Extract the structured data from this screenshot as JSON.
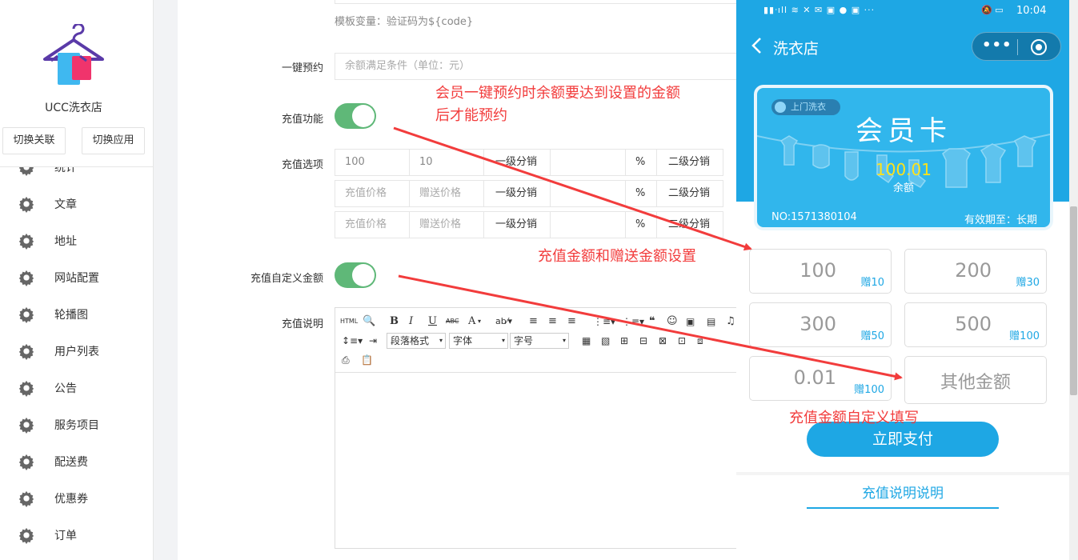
{
  "sidebar": {
    "shop_name": "UCC洗衣店",
    "buttons": [
      "切换关联",
      "切换应用"
    ],
    "items": [
      {
        "label": "统计"
      },
      {
        "label": "文章"
      },
      {
        "label": "地址"
      },
      {
        "label": "网站配置"
      },
      {
        "label": "轮播图"
      },
      {
        "label": "用户列表"
      },
      {
        "label": "公告"
      },
      {
        "label": "服务项目"
      },
      {
        "label": "配送费"
      },
      {
        "label": "优惠券"
      },
      {
        "label": "订单"
      }
    ]
  },
  "form": {
    "template_hint": "模板变量：验证码为${code}",
    "one_click": {
      "label": "一键预约",
      "placeholder": "余额满足条件（单位：元）"
    },
    "recharge_toggle": {
      "label": "充值功能",
      "on": true
    },
    "recharge_options": {
      "label": "充值选项",
      "rows": [
        {
          "price": "100",
          "gift": "10",
          "level1": "一级分销",
          "percent": "%",
          "level2": "二级分销",
          "price_is_value": true
        },
        {
          "price": "充值价格",
          "gift": "赠送价格",
          "level1": "一级分销",
          "percent": "%",
          "level2": "二级分销",
          "price_is_value": false
        },
        {
          "price": "充值价格",
          "gift": "赠送价格",
          "level1": "一级分销",
          "percent": "%",
          "level2": "二级分销",
          "price_is_value": false
        }
      ]
    },
    "custom_amount_toggle": {
      "label": "充值自定义金额",
      "on": true
    },
    "recharge_desc": {
      "label": "充值说明",
      "toolbar": {
        "html": "HTML",
        "bold": "B",
        "italic": "I",
        "underline": "U",
        "strike": "ABC",
        "font_color": "A",
        "paragraph": "段落格式",
        "font_family": "字体",
        "font_size": "字号"
      }
    }
  },
  "phone": {
    "status_time": "10:04",
    "nav_title": "洗衣店",
    "card": {
      "tag": "上门洗衣",
      "title": "会员卡",
      "balance": "100.01",
      "balance_label": "余额",
      "number": "NO:1571380104",
      "expiry": "有效期至：长期"
    },
    "amounts": [
      {
        "amount": "100",
        "gift": "赠10"
      },
      {
        "amount": "200",
        "gift": "赠30"
      },
      {
        "amount": "300",
        "gift": "赠50"
      },
      {
        "amount": "500",
        "gift": "赠100"
      },
      {
        "amount": "0.01",
        "gift": "赠100"
      }
    ],
    "other_amount": "其他金额",
    "pay_button": "立即支付",
    "desc_link": "充值说明说明"
  },
  "annotations": {
    "one_click_note_line1": "会员一键预约时余额要达到设置的金额",
    "one_click_note_line2": "后才能预约",
    "recharge_note": "充值金额和赠送金额设置",
    "custom_note": "充值金额自定义填写"
  },
  "colors": {
    "accent_blue": "#1ea7e4",
    "toggle_green": "#5fb878",
    "annotation_red": "#f23c3c",
    "balance_yellow": "#ffe21a"
  }
}
